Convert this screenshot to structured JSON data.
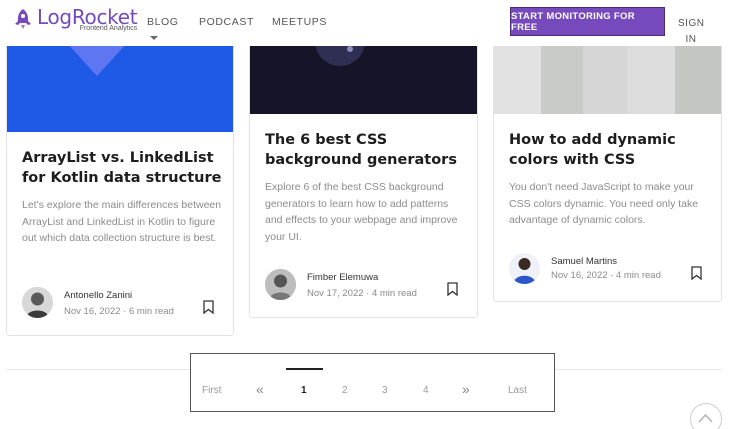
{
  "header": {
    "logo_name": "LogRocket",
    "logo_tagline": "Frontend Analytics",
    "nav": {
      "blog": "BLOG",
      "podcast": "PODCAST",
      "meetups": "MEETUPS"
    },
    "cta": "START MONITORING FOR FREE",
    "signin": "SIGN IN",
    "brand_color": "#764abc"
  },
  "cards": [
    {
      "title": "ArrayList vs. LinkedList for Kotlin data structure",
      "description": "Let's explore the main differences between ArrayList and LinkedList in Kotlin to figure out which data collection structure is best.",
      "author": "Antonello Zanini",
      "date": "Nov 16, 2022",
      "read_time": "6 min read"
    },
    {
      "title": "The 6 best CSS background generators",
      "description": "Explore 6 of the best CSS background generators to learn how to add patterns and effects to your webpage and improve your UI.",
      "author": "Fimber Elemuwa",
      "date": "Nov 17, 2022",
      "read_time": "4 min read"
    },
    {
      "title": "How to add dynamic colors with CSS",
      "description": "You don't need JavaScript to make your CSS colors dynamic. You need only take advantage of dynamic colors.",
      "author": "Samuel Martins",
      "date": "Nov 16, 2022",
      "read_time": "4 min read"
    }
  ],
  "pagination": {
    "first": "First",
    "prev": "«",
    "pages": [
      "1",
      "2",
      "3",
      "4"
    ],
    "current_page": "1",
    "next": "»",
    "last": "Last"
  },
  "meta_separator": "·"
}
